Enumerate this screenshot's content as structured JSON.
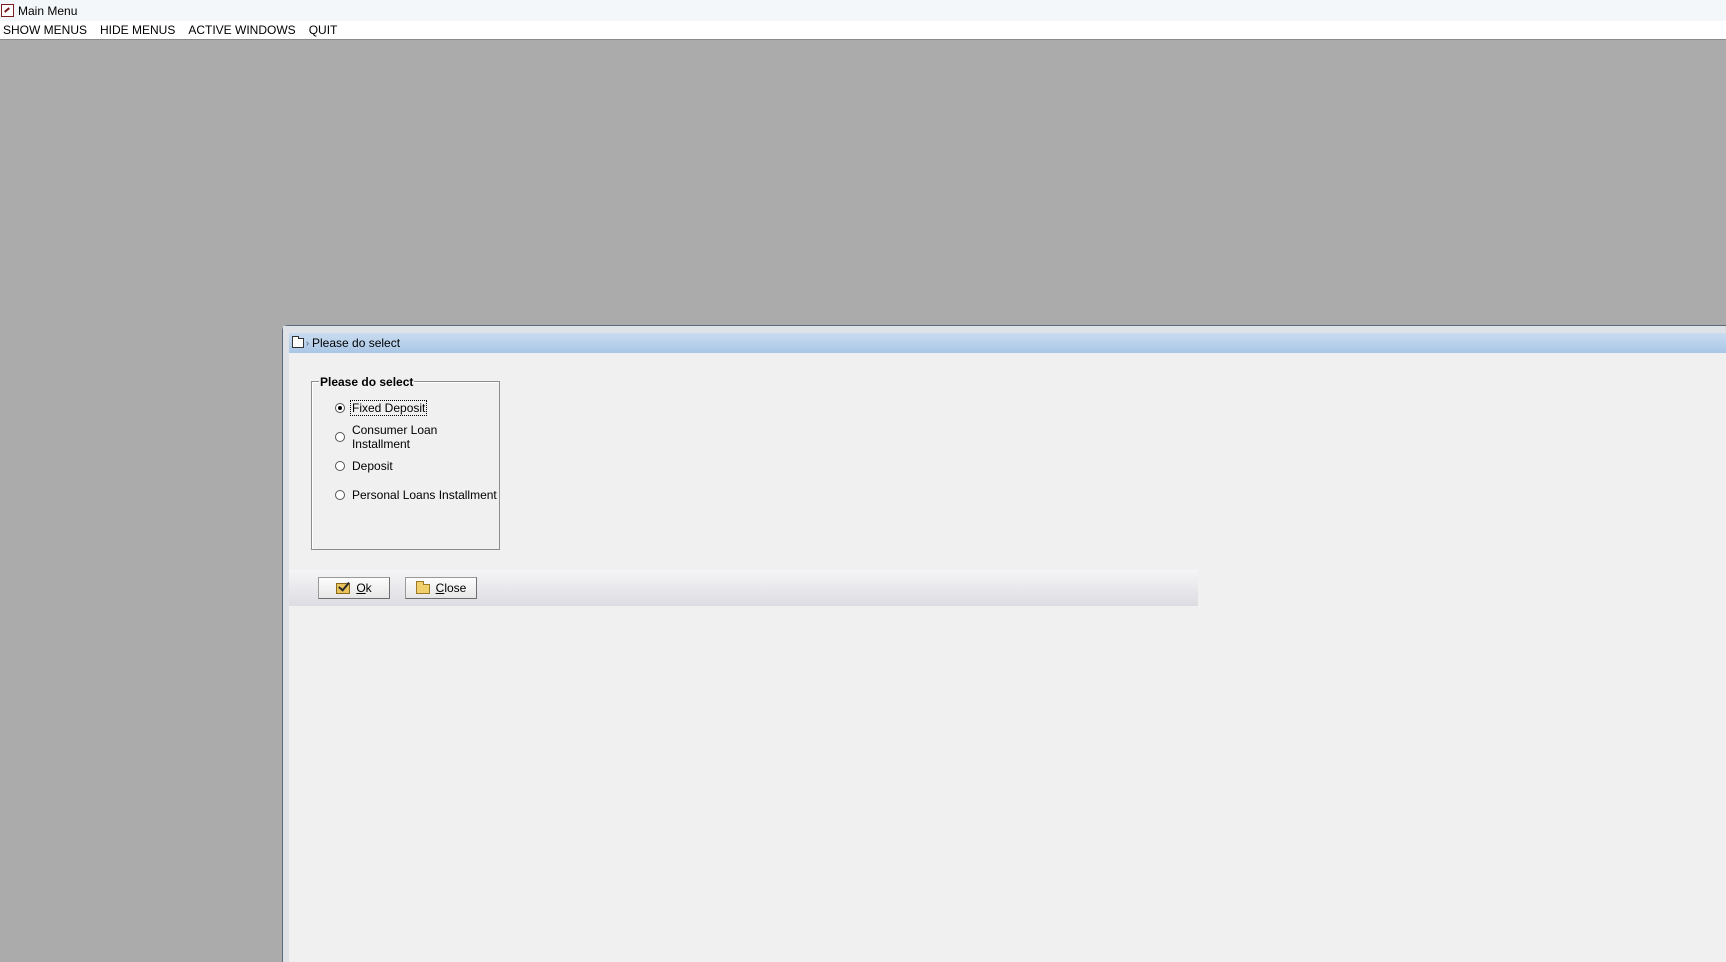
{
  "app": {
    "title": "Main Menu"
  },
  "menubar": {
    "items": [
      {
        "label": "SHOW MENUS"
      },
      {
        "label": "HIDE MENUS"
      },
      {
        "label": "ACTIVE WINDOWS"
      },
      {
        "label": "QUIT"
      }
    ]
  },
  "dialog": {
    "title": "Please do select",
    "group_label": "Please do select",
    "options": [
      {
        "label": "Fixed Deposit",
        "selected": true
      },
      {
        "label": "Consumer Loan Installment",
        "selected": false
      },
      {
        "label": "Deposit",
        "selected": false
      },
      {
        "label": "Personal Loans Installment",
        "selected": false
      }
    ],
    "buttons": {
      "ok_mnemonic": "O",
      "ok_rest": "k",
      "close_mnemonic": "C",
      "close_rest": "lose"
    }
  },
  "colors": {
    "desktop": "#ababab",
    "dialog_bg": "#f0f0f0",
    "dialog_titlebar": "#b7d0ea"
  }
}
